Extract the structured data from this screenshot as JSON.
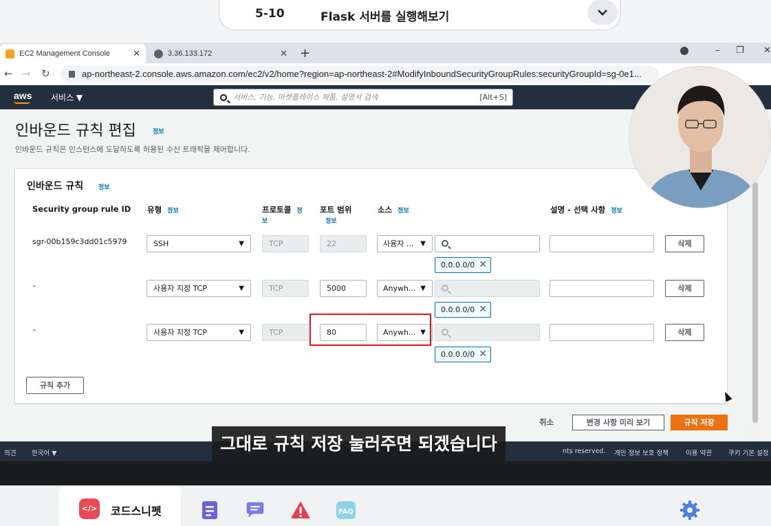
{
  "lesson": {
    "number": "5-10",
    "title": "Flask 서버를 실행해보기"
  },
  "browser": {
    "tabs": [
      {
        "label": "EC2 Management Console"
      },
      {
        "label": "3.36.133.172"
      }
    ],
    "url": "ap-northeast-2.console.aws.amazon.com/ec2/v2/home?region=ap-northeast-2#ModifyInboundSecurityGroupRules:securityGroupId=sg-0e1..."
  },
  "aws_nav": {
    "logo": "aws",
    "services": "서비스 ▼",
    "search_placeholder": "서비스, 기능, 마켓플레이스 제품, 설명서 검색",
    "search_shortcut": "[Alt+S]"
  },
  "page": {
    "title": "인바운드 규칙 편집",
    "title_info": "정보",
    "description": "인바운드 규칙은 인스턴스에 도달하도록 허용된 수신 트래픽을 제어합니다."
  },
  "panel": {
    "title": "인바운드 규칙",
    "title_info": "정보",
    "columns": {
      "rule_id": "Security group rule ID",
      "type": "유형",
      "type_info": "정보",
      "protocol": "프로토콜",
      "protocol_info_1": "정",
      "protocol_info_2": "보",
      "port": "포트 범위",
      "port_info": "정보",
      "source": "소스",
      "source_info": "정보",
      "description": "설명 - 선택 사항",
      "description_info": "정보"
    },
    "rules": [
      {
        "id": "sgr-00b159c3dd01c5979",
        "type": "SSH",
        "protocol": "TCP",
        "port": "22",
        "source": "사용자 ...",
        "cidr": "0.0.0.0/0",
        "delete": "삭제"
      },
      {
        "id": "–",
        "type": "사용자 지정 TCP",
        "protocol": "TCP",
        "port": "5000",
        "source": "Anywh...",
        "cidr": "0.0.0.0/0",
        "delete": "삭제"
      },
      {
        "id": "–",
        "type": "사용자 지정 TCP",
        "protocol": "TCP",
        "port": "80",
        "source": "Anywh...",
        "cidr": "0.0.0.0/0",
        "delete": "삭제"
      }
    ],
    "add_rule": "규칙 추가"
  },
  "actions": {
    "cancel": "취소",
    "preview": "변경 사항 미리 보기",
    "save": "규칙 저장"
  },
  "footer": {
    "feedback": "의견",
    "language": "한국어 ▼",
    "copyright": "nts reserved.",
    "privacy": "개인 정보 보호 정책",
    "terms": "이용 약관",
    "cookies": "쿠키 기본 설정"
  },
  "subtitle": "그대로 규칙 저장 눌러주면 되겠습니다",
  "dock": {
    "brand": "코드스니펫",
    "faq": "FAQ"
  },
  "colors": {
    "aws_nav": "#232f3e",
    "aws_orange": "#ec7211",
    "link_blue": "#0073bb",
    "highlight_red": "#e3131a",
    "brand_red": "#e84b55"
  },
  "icons": [
    "chevron-down-icon",
    "favicon-aws",
    "globe-icon",
    "close-icon",
    "plus-icon",
    "back-icon",
    "forward-icon",
    "reload-icon",
    "lock-icon",
    "search-icon",
    "checklist-icon",
    "chat-icon",
    "warning-icon",
    "faq-icon",
    "gear-icon"
  ]
}
